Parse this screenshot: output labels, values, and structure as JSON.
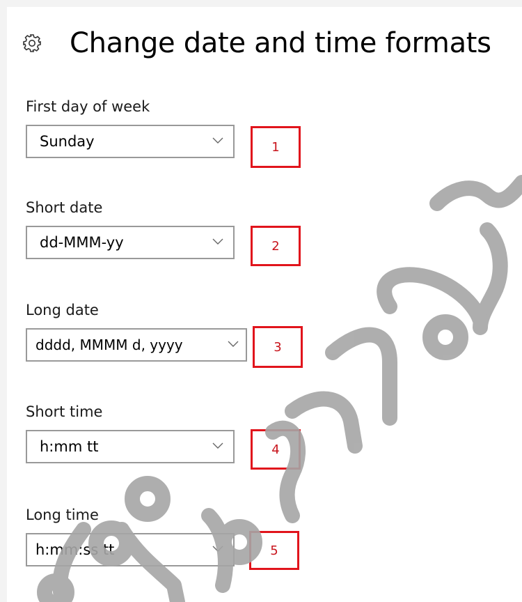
{
  "page": {
    "title": "Change date and time formats",
    "icon": "gear-icon"
  },
  "settings": [
    {
      "label": "First day of week",
      "value": "Sunday",
      "marker": "1"
    },
    {
      "label": "Short date",
      "value": "dd-MMM-yy",
      "marker": "2"
    },
    {
      "label": "Long date",
      "value": "dddd, MMMM d, yyyy",
      "marker": "3"
    },
    {
      "label": "Short time",
      "value": "h:mm tt",
      "marker": "4"
    },
    {
      "label": "Long time",
      "value": "h:mm:ss tt",
      "marker": "5"
    }
  ],
  "colors": {
    "marker_border": "#e1141c",
    "marker_text": "#c8141c",
    "dropdown_border": "#999999",
    "watermark": "#a6a6a6"
  }
}
